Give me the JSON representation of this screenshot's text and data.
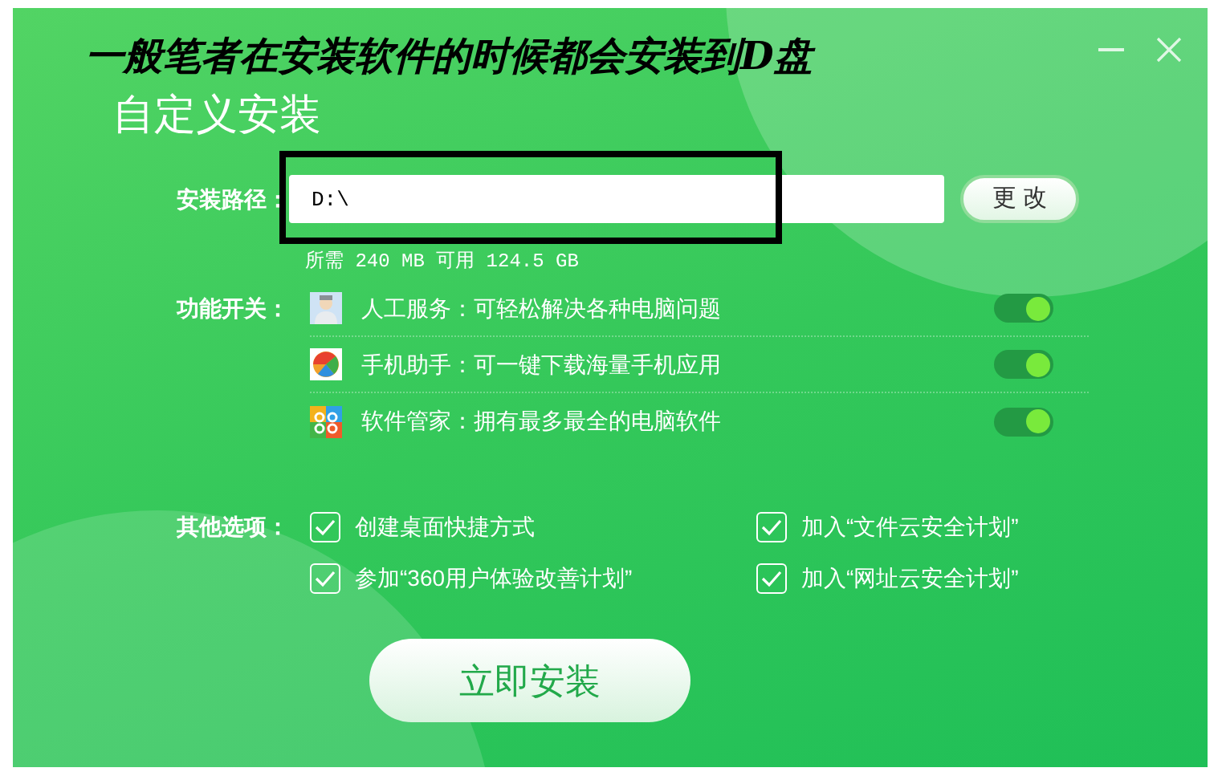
{
  "annotation": "一般笔者在安装软件的时候都会安装到D盘",
  "window": {
    "title": "自定义安装"
  },
  "install_path": {
    "label": "安装路径：",
    "value": "D:\\",
    "change_button": "更 改",
    "space_info": "所需 240 MB 可用 124.5 GB"
  },
  "features": {
    "label": "功能开关：",
    "items": [
      {
        "kind": "service",
        "text": "人工服务：可轻松解决各种电脑问题",
        "on": true
      },
      {
        "kind": "phone",
        "text": "手机助手：可一键下载海量手机应用",
        "on": true
      },
      {
        "kind": "manager",
        "text": "软件管家：拥有最多最全的电脑软件",
        "on": true
      }
    ]
  },
  "options": {
    "label": "其他选项：",
    "items": [
      {
        "text": "创建桌面快捷方式",
        "checked": true
      },
      {
        "text": "加入“文件云安全计划”",
        "checked": true
      },
      {
        "text": "参加“360用户体验改善计划”",
        "checked": true
      },
      {
        "text": "加入“网址云安全计划”",
        "checked": true
      }
    ]
  },
  "install_button": "立即安装"
}
